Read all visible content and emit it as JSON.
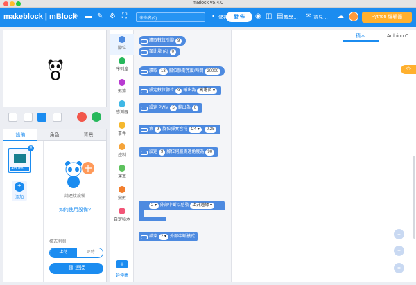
{
  "window": {
    "title": "mBlock v5.4.0"
  },
  "toolbar": {
    "logo": "makeblock | mBlock",
    "filename_placeholder": "未命名(9)",
    "save_label": "儲存",
    "share_label": "發 佈",
    "tutorial_label": "教學…",
    "feedback_label": "意見…",
    "python_label": "Python 编辑器"
  },
  "device_panel": {
    "tabs": [
      "設備",
      "角色",
      "背景"
    ],
    "device_name": "Arduino …",
    "add_label": "添加",
    "hint": "請連接設備",
    "howto_link": "如何使用設備?",
    "mode_label": "模式開關",
    "mode_upload": "上傳",
    "mode_live": "即時",
    "connect_label": "連接"
  },
  "categories": [
    {
      "name": "腳位",
      "color": "#4d8ae0"
    },
    {
      "name": "序列埠",
      "color": "#27b85c"
    },
    {
      "name": "數據",
      "color": "#b83bd1"
    },
    {
      "name": "感測器",
      "color": "#3fb8e6"
    },
    {
      "name": "事件",
      "color": "#f5b82e"
    },
    {
      "name": "控制",
      "color": "#f5a43a"
    },
    {
      "name": "運算",
      "color": "#5ec25e"
    },
    {
      "name": "變數",
      "color": "#f27f2e"
    },
    {
      "name": "自定積木",
      "color": "#f25577"
    }
  ],
  "extension_label": "延伸集",
  "blocks": {
    "b1": {
      "text": "讀取數位引腳",
      "v1": "9"
    },
    "b2": {
      "text": "類比埠 (A)",
      "v1": "0"
    },
    "b3": {
      "pre": "讀取",
      "v1": "13",
      "text": "腳位脈衝寬度/時間",
      "v2": "20000"
    },
    "b4": {
      "pre": "設定數位腳位",
      "v1": "9",
      "text": "輸出為",
      "v2": "高電位 ▾"
    },
    "b5": {
      "pre": "設定 PWM",
      "v1": "5",
      "text": "輸出為",
      "v2": "0"
    },
    "b6": {
      "pre": "第",
      "v1": "9",
      "text": "腳位彈奏音符",
      "v2": "C4 ▾",
      "v3": "0.25"
    },
    "b7": {
      "pre": "設定",
      "v1": "9",
      "text": "腳位伺服馬達角度為",
      "v2": "90"
    },
    "b8": {
      "v1": "2 ▾",
      "text": "外部中斷以信號",
      "v2": "上升邊緣 ▾"
    },
    "b9": {
      "pre": "結束",
      "v1": "2 ▾",
      "text": "外部中斷模式"
    }
  },
  "code_tabs": {
    "blocks": "積木",
    "arduino": "Arduino C"
  },
  "side_handle": "</>",
  "zoom": {
    "in": "+",
    "out": "−",
    "reset": "="
  }
}
